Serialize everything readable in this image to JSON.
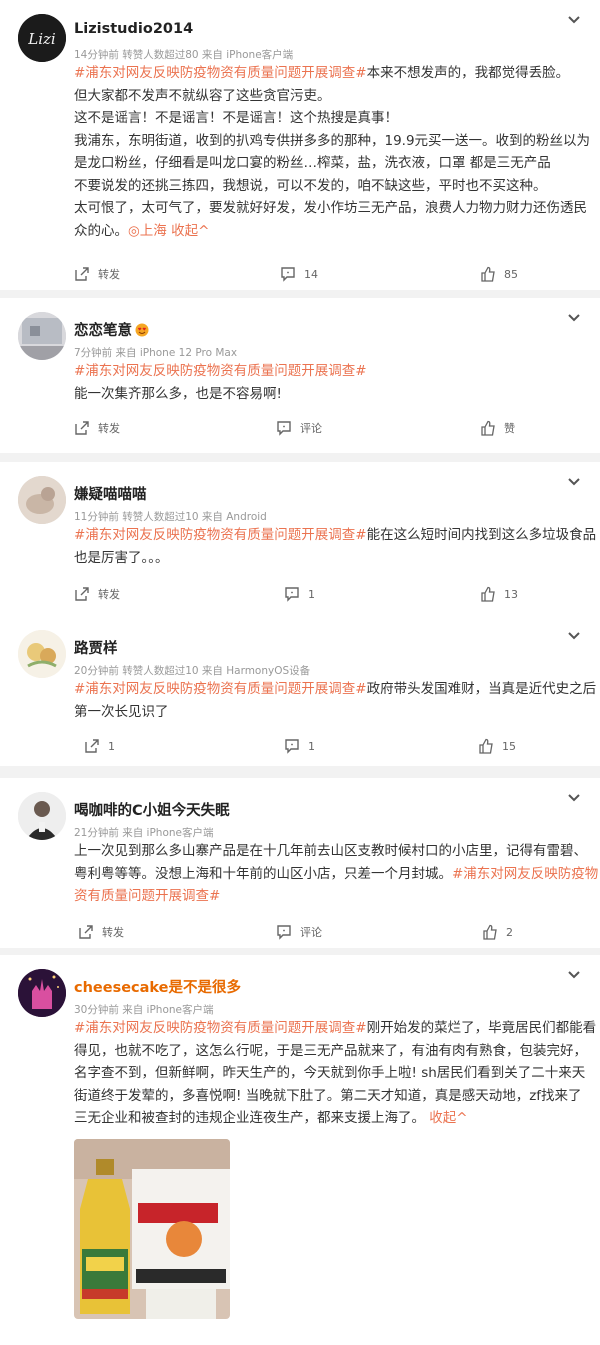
{
  "posts": [
    {
      "username": "Lizistudio2014",
      "avatar_text": "Lizi",
      "meta": "14分钟前  转赞人数超过80  来自 iPhone客户端",
      "lines": [
        {
          "tag": "#浦东对网友反映防疫物资有质量问题开展调查#",
          "text": "本来不想发声的，我都觉得丢脸。"
        },
        {
          "text": "但大家都不发声不就纵容了这些贪官污吏。"
        },
        {
          "text": "这不是谣言！不是谣言！不是谣言！这个热搜是真事！"
        },
        {
          "text": "我浦东，东明街道，收到的扒鸡专供拼多多的那种，19.9元买一送一。收到的粉丝以为"
        },
        {
          "text": "是龙口粉丝，仔细看是叫龙口宴的粉丝…榨菜，盐，洗衣液，口罩 都是三无产品"
        },
        {
          "text": "不要说发的还挑三拣四，我想说，可以不发的，咱不缺这些，平时也不买这种。"
        },
        {
          "text": "太可恨了，太可气了，要发就好好发，发小作坊三无产品，浪费人力物力财力还伤透民"
        },
        {
          "text": "众的心。",
          "location": "◎上海",
          "collapse": "收起^"
        }
      ],
      "repost": "转发",
      "comment": "14",
      "like": "85"
    },
    {
      "username": "恋恋笔意",
      "meta": "7分钟前  来自 iPhone 12 Pro Max",
      "lines": [
        {
          "tag": "#浦东对网友反映防疫物资有质量问题开展调查#"
        },
        {
          "text": "能一次集齐那么多，也是不容易啊!"
        }
      ],
      "repost": "转发",
      "comment": "评论",
      "like": "赞"
    },
    {
      "username": "嫌疑喵喵喵",
      "meta": "11分钟前  转赞人数超过10  来自 Android",
      "lines": [
        {
          "tag": "#浦东对网友反映防疫物资有质量问题开展调查#",
          "text": "能在这么短时间内找到这么多垃圾食品"
        },
        {
          "text": "也是厉害了。。。"
        }
      ],
      "repost": "转发",
      "comment": "1",
      "like": "13"
    },
    {
      "username": "路贾样",
      "meta": "20分钟前  转赞人数超过10  来自 HarmonyOS设备",
      "lines": [
        {
          "tag": "#浦东对网友反映防疫物资有质量问题开展调查#",
          "text": "政府带头发国难财，当真是近代史之后"
        },
        {
          "text": "第一次长见识了"
        }
      ],
      "repost": "1",
      "comment": "1",
      "like": "15"
    },
    {
      "username": "喝咖啡的C小姐今天失眠",
      "meta": "21分钟前  来自 iPhone客户端",
      "lines": [
        {
          "text": "上一次见到那么多山寨产品是在十几年前去山区支教时候村口的小店里，记得有雷碧、"
        },
        {
          "text": "粤利粤等等。没想上海和十年前的山区小店，只差一个月封城。",
          "tag": "#浦东对网友反映防疫物"
        },
        {
          "tag": "资有质量问题开展调查#"
        }
      ],
      "repost": "转发",
      "comment": "评论",
      "like": "2"
    },
    {
      "username": "cheesecake是不是很多",
      "meta": "30分钟前  来自 iPhone客户端",
      "lines": [
        {
          "tag": "#浦东对网友反映防疫物资有质量问题开展调查#",
          "text": "刚开始发的菜烂了，毕竟居民们都能看"
        },
        {
          "text": "得见，也就不吃了，这怎么行呢，于是三无产品就来了，有油有肉有熟食，包装完好，"
        },
        {
          "text": "名字查不到，但新鲜啊，昨天生产的，今天就到你手上啦! sh居民们看到关了二十来天"
        },
        {
          "text": "街道终于发荤的，多喜悦啊! 当晚就下肚了。第二天才知道，真是感天动地，zf找来了"
        },
        {
          "text": "三无企业和被查封的违规企业连夜生产，都来支援上海了。",
          "collapse": "收起^"
        }
      ],
      "photo_caption": ""
    }
  ],
  "colors": {
    "topic": "#eb7350",
    "username_orange": "#e86a00",
    "meta": "#999999",
    "bg": "#f2f2f2"
  },
  "icons": [
    "repost-icon",
    "comment-icon",
    "like-icon",
    "chevron-down-icon",
    "location-icon"
  ]
}
